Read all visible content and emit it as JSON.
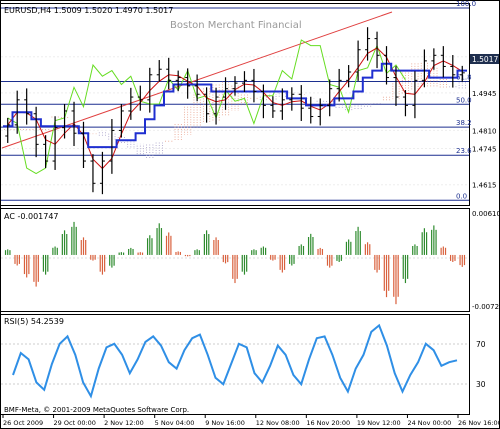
{
  "header": {
    "symbol_line": "EURUSD,H4  1.5009 1.5020 1.4970 1.5017",
    "watermark": "Boston Merchant Financial",
    "price_label": "1.5017"
  },
  "fib_levels": [
    {
      "label": "100.0",
      "price": 1.525
    },
    {
      "label": "61.8",
      "price": 1.4986
    },
    {
      "label": "50.0",
      "price": 1.4904
    },
    {
      "label": "38.2",
      "price": 1.4822
    },
    {
      "label": "23.6",
      "price": 1.4721
    },
    {
      "label": "0.0",
      "price": 1.4559
    }
  ],
  "ac_panel": {
    "title": "AC -0.001747",
    "max_label": "0.006107",
    "min_label": "-0.00726"
  },
  "rsi_panel": {
    "title": "RSI(5) 54.2539",
    "levels": [
      "70",
      "30"
    ]
  },
  "footer": {
    "copyright": "BMF-Meta, © 2001-2009 MetaQuotes Software Corp."
  },
  "colors": {
    "bull_bar": "#2e8b2e",
    "bear_bar": "#d9603c",
    "rsi_line": "#2f8fe6",
    "kijun": "#1f2fd0",
    "tenkan": "#cc1111",
    "chikou": "#66dd22",
    "fib": "#1c2f8f"
  },
  "chart_data": [
    {
      "type": "line",
      "title": "EURUSD,H4",
      "ylabel": "",
      "x_ticks": [
        "26 Oct 2009",
        "29 Oct 00:00",
        "2 Nov 12:00",
        "5 Nov 04:00",
        "9 Nov 16:00",
        "12 Nov 08:00",
        "16 Nov 20:00",
        "19 Nov 12:00",
        "24 Nov 00:00",
        "26 Nov 16:00"
      ],
      "y_ticks": [
        1.5075,
        1.4945,
        1.481,
        1.4745,
        1.4615
      ],
      "ylim": [
        1.456,
        1.525
      ],
      "series": [
        {
          "name": "close",
          "values": [
            1.483,
            1.492,
            1.487,
            1.476,
            1.47,
            1.482,
            1.488,
            1.48,
            1.47,
            1.462,
            1.47,
            1.481,
            1.488,
            1.493,
            1.492,
            1.501,
            1.503,
            1.499,
            1.5,
            1.497,
            1.494,
            1.487,
            1.493,
            1.496,
            1.498,
            1.499,
            1.495,
            1.49,
            1.488,
            1.492,
            1.494,
            1.489,
            1.486,
            1.49,
            1.496,
            1.499,
            1.502,
            1.51,
            1.514,
            1.508,
            1.5,
            1.493,
            1.49,
            1.499,
            1.506,
            1.508,
            1.504,
            1.501,
            1.5017
          ]
        }
      ],
      "annotations": [
        "Boston Merchant Financial"
      ]
    },
    {
      "type": "bar",
      "title": "AC -0.001747",
      "ylim": [
        -0.00726,
        0.006107
      ],
      "values": [
        0.0008,
        -0.0015,
        -0.0032,
        -0.0045,
        -0.0028,
        0.0012,
        0.0035,
        0.0047,
        0.0025,
        -0.0008,
        -0.0028,
        -0.0018,
        0.0004,
        0.001,
        0.0004,
        0.0028,
        0.0045,
        0.0032,
        0.0005,
        -0.0002,
        0.0008,
        0.0035,
        0.0025,
        -0.0012,
        -0.004,
        -0.0028,
        0.0008,
        0.0012,
        -0.0008,
        -0.0025,
        -0.0015,
        0.0015,
        0.003,
        0.001,
        -0.0018,
        -0.001,
        0.0022,
        0.004,
        0.0018,
        -0.0025,
        -0.006,
        -0.007,
        -0.004,
        0.0015,
        0.0038,
        0.0042,
        0.0012,
        -0.001,
        -0.0017
      ]
    },
    {
      "type": "line",
      "title": "RSI(5) 54.2539",
      "ylim": [
        0,
        100
      ],
      "series": [
        {
          "name": "RSI(5)",
          "values": [
            38,
            62,
            55,
            30,
            22,
            50,
            72,
            80,
            60,
            30,
            15,
            45,
            68,
            72,
            60,
            40,
            55,
            74,
            80,
            70,
            52,
            45,
            65,
            78,
            82,
            60,
            35,
            28,
            50,
            72,
            68,
            40,
            30,
            48,
            70,
            60,
            38,
            28,
            55,
            78,
            80,
            60,
            35,
            20,
            45,
            60,
            85,
            92,
            70,
            40,
            20,
            38,
            52,
            72,
            65,
            48,
            52,
            54
          ]
        }
      ]
    }
  ]
}
